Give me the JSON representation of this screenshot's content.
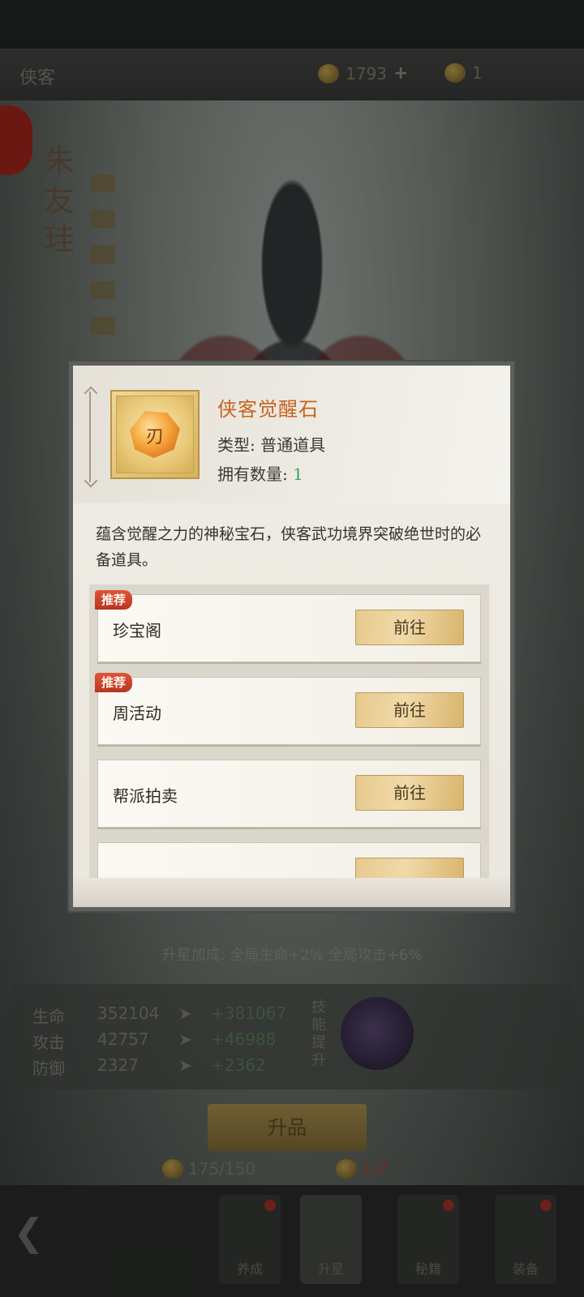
{
  "topbar": {
    "title": "侠客",
    "currency_gold": "1793",
    "currency_plus": "+",
    "currency_token": "1"
  },
  "hero": {
    "name": "朱友珪"
  },
  "upgrade_bonus": "升星加成: 全局生命+2% 全局攻击+6%",
  "stats": [
    {
      "label": "生命",
      "current": "352104",
      "next": "+381067"
    },
    {
      "label": "攻击",
      "current": "42757",
      "next": "+46988"
    },
    {
      "label": "防御",
      "current": "2327",
      "next": "+2362"
    }
  ],
  "skill_text": "技能提升",
  "upgrade_button": "升品",
  "costs": [
    {
      "value": "175/150"
    },
    {
      "value": "1/2"
    }
  ],
  "bottom_nav": [
    {
      "label": "养成"
    },
    {
      "label": "升星"
    },
    {
      "label": "秘籍"
    },
    {
      "label": "装备"
    }
  ],
  "modal": {
    "item_name": "侠客觉醒石",
    "type_label": "类型: 普通道具",
    "count_label": "拥有数量: ",
    "count_value": "1",
    "gem_mark": "刃",
    "description": "蕴含觉醒之力的神秘宝石，侠客武功境界突破绝世时的必备道具。",
    "sources": [
      {
        "name": "珍宝阁",
        "badge": "推荐",
        "button": "前往"
      },
      {
        "name": "周活动",
        "badge": "推荐",
        "button": "前往"
      },
      {
        "name": "帮派拍卖",
        "badge": "",
        "button": "前往"
      },
      {
        "name": "",
        "badge": "",
        "button": ""
      }
    ]
  },
  "colors": {
    "accent_orange": "#c8631e",
    "count_green": "#3aa064",
    "badge_red": "#c8412a",
    "button_gold": "#e7c98e"
  }
}
